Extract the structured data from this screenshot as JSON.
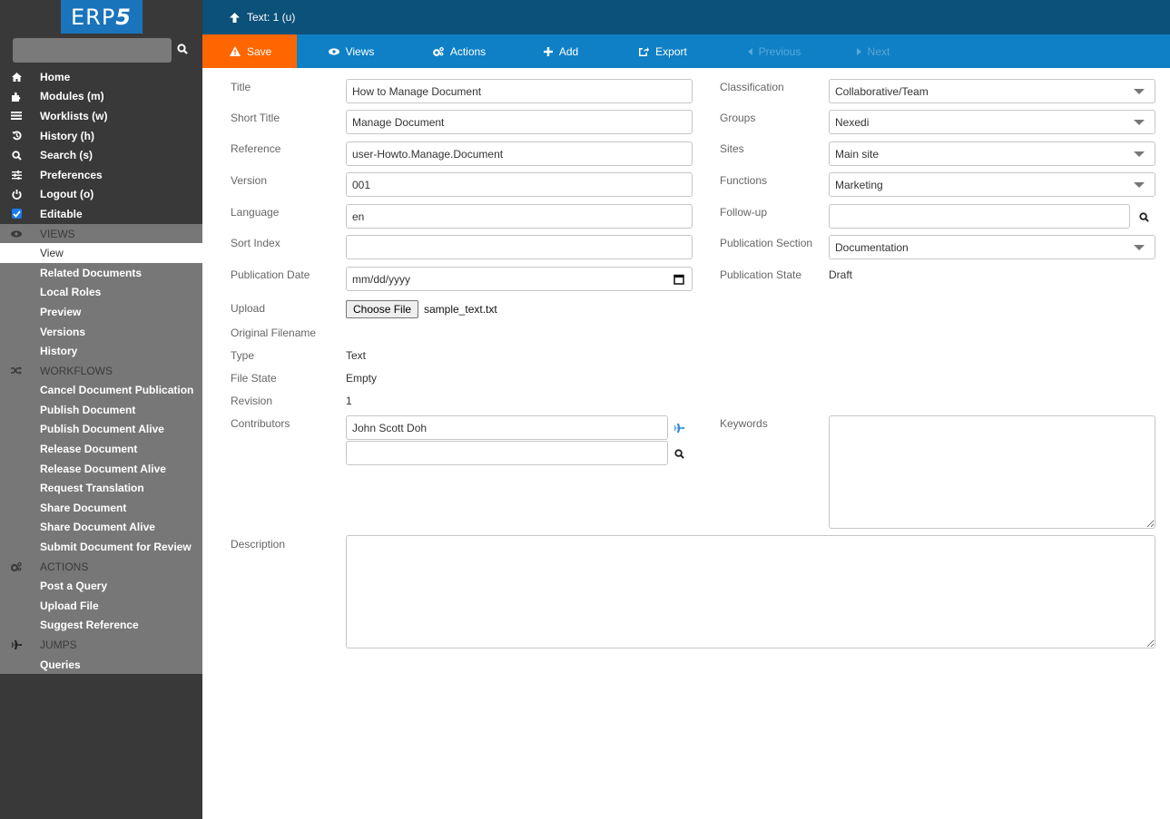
{
  "app": {
    "logo_text": "ERP",
    "logo_accent": "5"
  },
  "sidebar": {
    "search_placeholder": "",
    "nav": [
      {
        "label": "Home",
        "icon": "home-icon"
      },
      {
        "label": "Modules (m)",
        "icon": "puzzle-icon"
      },
      {
        "label": "Worklists (w)",
        "icon": "tasks-icon"
      },
      {
        "label": "History (h)",
        "icon": "history-icon"
      },
      {
        "label": "Search (s)",
        "icon": "search-icon"
      },
      {
        "label": "Preferences",
        "icon": "sliders-icon"
      },
      {
        "label": "Logout (o)",
        "icon": "power-icon"
      },
      {
        "label": "Editable",
        "icon": "checkbox-icon",
        "checked": true
      }
    ],
    "views": {
      "title": "VIEWS",
      "items": [
        "View",
        "Related Documents",
        "Local Roles",
        "Preview",
        "Versions",
        "History"
      ],
      "active": "View"
    },
    "workflows": {
      "title": "WORKFLOWS",
      "items": [
        "Cancel Document Publication",
        "Publish Document",
        "Publish Document Alive",
        "Release Document",
        "Release Document Alive",
        "Request Translation",
        "Share Document",
        "Share Document Alive",
        "Submit Document for Review"
      ]
    },
    "actions": {
      "title": "ACTIONS",
      "items": [
        "Post a Query",
        "Upload File",
        "Suggest Reference"
      ]
    },
    "jumps": {
      "title": "JUMPS",
      "items": [
        "Queries"
      ]
    }
  },
  "header": {
    "breadcrumb": "Text: 1 (u)"
  },
  "toolbar": {
    "save": "Save",
    "views": "Views",
    "actions": "Actions",
    "add": "Add",
    "export": "Export",
    "previous": "Previous",
    "next": "Next"
  },
  "form": {
    "title": {
      "label": "Title",
      "value": "How to Manage Document"
    },
    "short_title": {
      "label": "Short Title",
      "value": "Manage Document"
    },
    "reference": {
      "label": "Reference",
      "value": "user-Howto.Manage.Document"
    },
    "version": {
      "label": "Version",
      "value": "001"
    },
    "language": {
      "label": "Language",
      "value": "en"
    },
    "sort_index": {
      "label": "Sort Index",
      "value": ""
    },
    "publication_date": {
      "label": "Publication Date",
      "placeholder": "mm/dd/yyyy"
    },
    "upload": {
      "label": "Upload",
      "button": "Choose File",
      "filename": "sample_text.txt"
    },
    "original_filename": {
      "label": "Original Filename",
      "value": ""
    },
    "type": {
      "label": "Type",
      "value": "Text"
    },
    "file_state": {
      "label": "File State",
      "value": "Empty"
    },
    "revision": {
      "label": "Revision",
      "value": "1"
    },
    "contributors": {
      "label": "Contributors",
      "values": [
        "John Scott Doh",
        ""
      ]
    },
    "description": {
      "label": "Description",
      "value": ""
    },
    "classification": {
      "label": "Classification",
      "value": "Collaborative/Team"
    },
    "groups": {
      "label": "Groups",
      "value": "Nexedi"
    },
    "sites": {
      "label": "Sites",
      "value": "Main site"
    },
    "functions": {
      "label": "Functions",
      "value": "Marketing"
    },
    "follow_up": {
      "label": "Follow-up",
      "value": ""
    },
    "publication_section": {
      "label": "Publication Section",
      "value": "Documentation"
    },
    "publication_state": {
      "label": "Publication State",
      "value": "Draft"
    },
    "keywords": {
      "label": "Keywords",
      "value": ""
    }
  },
  "colors": {
    "header": "#0b5179",
    "toolbar": "#0f80c5",
    "save": "#ff6600",
    "sidebar": "#393939",
    "sidebar_section": "#777777",
    "logo": "#1a74bb",
    "jump_icon": "#2a8ad8"
  }
}
